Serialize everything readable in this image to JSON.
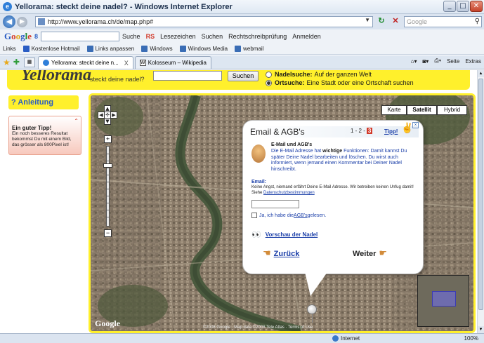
{
  "window": {
    "title": "Yellorama: steckt deine nadel? - Windows Internet Explorer"
  },
  "address": {
    "url": "http://www.yellorama.ch/de/map.php#",
    "search_placeholder": "Google"
  },
  "google_toolbar": {
    "label_8": "8",
    "items": [
      "Suche",
      "RS",
      "Lesezeichen",
      "Suchen",
      "Rechtschreibprüfung",
      "Anmelden"
    ]
  },
  "links_bar": {
    "prefix": "Links",
    "items": [
      "Kostenlose Hotmail",
      "Links anpassen",
      "Windows",
      "Windows Media",
      "webmail"
    ]
  },
  "tabs": [
    {
      "label": "Yellorama: steckt deine n...",
      "close": "X"
    },
    {
      "label": "Kolosseum – Wikipedia"
    }
  ],
  "cmdbar": {
    "page": "Seite",
    "extras": "Extras"
  },
  "site": {
    "logo": "Yellorama",
    "slogan": "steckt deine nadel?",
    "search_button": "Suchen",
    "options": [
      {
        "bold": "Nadelsuche:",
        "text": "Auf der ganzen Welt"
      },
      {
        "bold": "Ortsuche:",
        "text": "Eine Stadt oder eine Ortschaft suchen"
      }
    ],
    "anleitung": "? Anleitung",
    "tip": {
      "title": "Ein guter Tipp!",
      "text": "Ein noch besseres Resultat bekommst Du mit einem Bild, das grösser als 800Pixel ist!"
    }
  },
  "map": {
    "types": [
      "Karte",
      "Satellit",
      "Hybrid"
    ],
    "active_type": "Satellit",
    "copyright": "©2008 Google · Map data ©2008 Tele Atlas · Terms of Use",
    "logo": "Google"
  },
  "dialog": {
    "title": "Email & AGB's",
    "steps": "1 - 2 -",
    "current_step": "3",
    "tipp": "Tipp!",
    "intro_head": "E-Mail und AGB's",
    "intro_1": "Die E-Mail Adresse hat ",
    "intro_bold": "wichtige",
    "intro_2": " Funktionen: Damit kannst Du später Deine Nadel bearbeiten und löschen. Du wirst auch informiert, wenn jemand einen Kommentar bei Deiner Nadel hinschreibt.",
    "email_label": "Email:",
    "email_text": "Keine Angst, niemand erfährt Deine E-Mail Adresse. Wir betreiben keinen Unfug damit! Siehe ",
    "privacy_link": "Datenschutzbestimmungen",
    "email_value": "",
    "agb_prefix": "Ja, ich habe die ",
    "agb_link": "AGB's",
    "agb_suffix": " gelesen.",
    "preview": "Vorschau der Nadel",
    "back": "Zurück",
    "next": "Weiter"
  },
  "status": {
    "zone": "Internet",
    "zoom": "100%"
  }
}
